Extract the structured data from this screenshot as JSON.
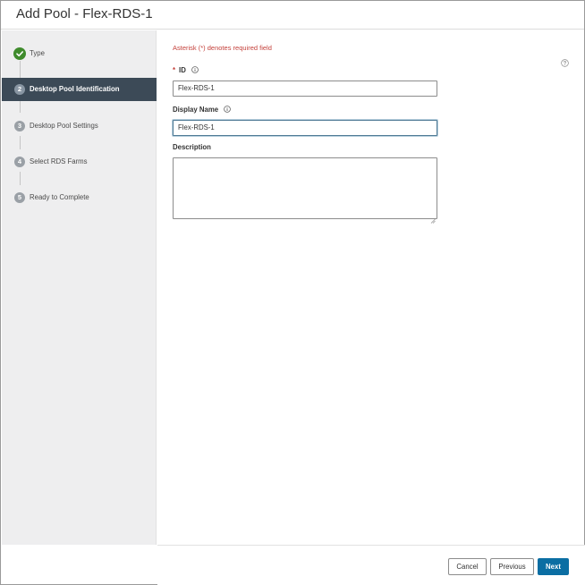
{
  "dialog": {
    "title": "Add Pool - Flex-RDS-1"
  },
  "wizard": {
    "steps": [
      {
        "number": "✓",
        "label": "Type",
        "state": "done"
      },
      {
        "number": "2",
        "label": "Desktop Pool Identification",
        "state": "active"
      },
      {
        "number": "3",
        "label": "Desktop Pool Settings",
        "state": "pending"
      },
      {
        "number": "4",
        "label": "Select RDS Farms",
        "state": "pending"
      },
      {
        "number": "5",
        "label": "Ready to Complete",
        "state": "pending"
      }
    ]
  },
  "form": {
    "required_note": "Asterisk (*) denotes required field",
    "id_label": "ID",
    "id_required_marker": "*",
    "id_value": "Flex-RDS-1",
    "display_name_label": "Display Name",
    "display_name_value": "Flex-RDS-1",
    "description_label": "Description",
    "description_value": ""
  },
  "footer": {
    "cancel_label": "Cancel",
    "previous_label": "Previous",
    "next_label": "Next"
  },
  "colors": {
    "active_step_bg": "#3c4a57",
    "done_step": "#3f8b2c",
    "required_text": "#c4413b",
    "primary_button": "#0b6ea3"
  },
  "icons": [
    "check-icon",
    "help-icon",
    "info-icon",
    "resize-grip-icon"
  ]
}
